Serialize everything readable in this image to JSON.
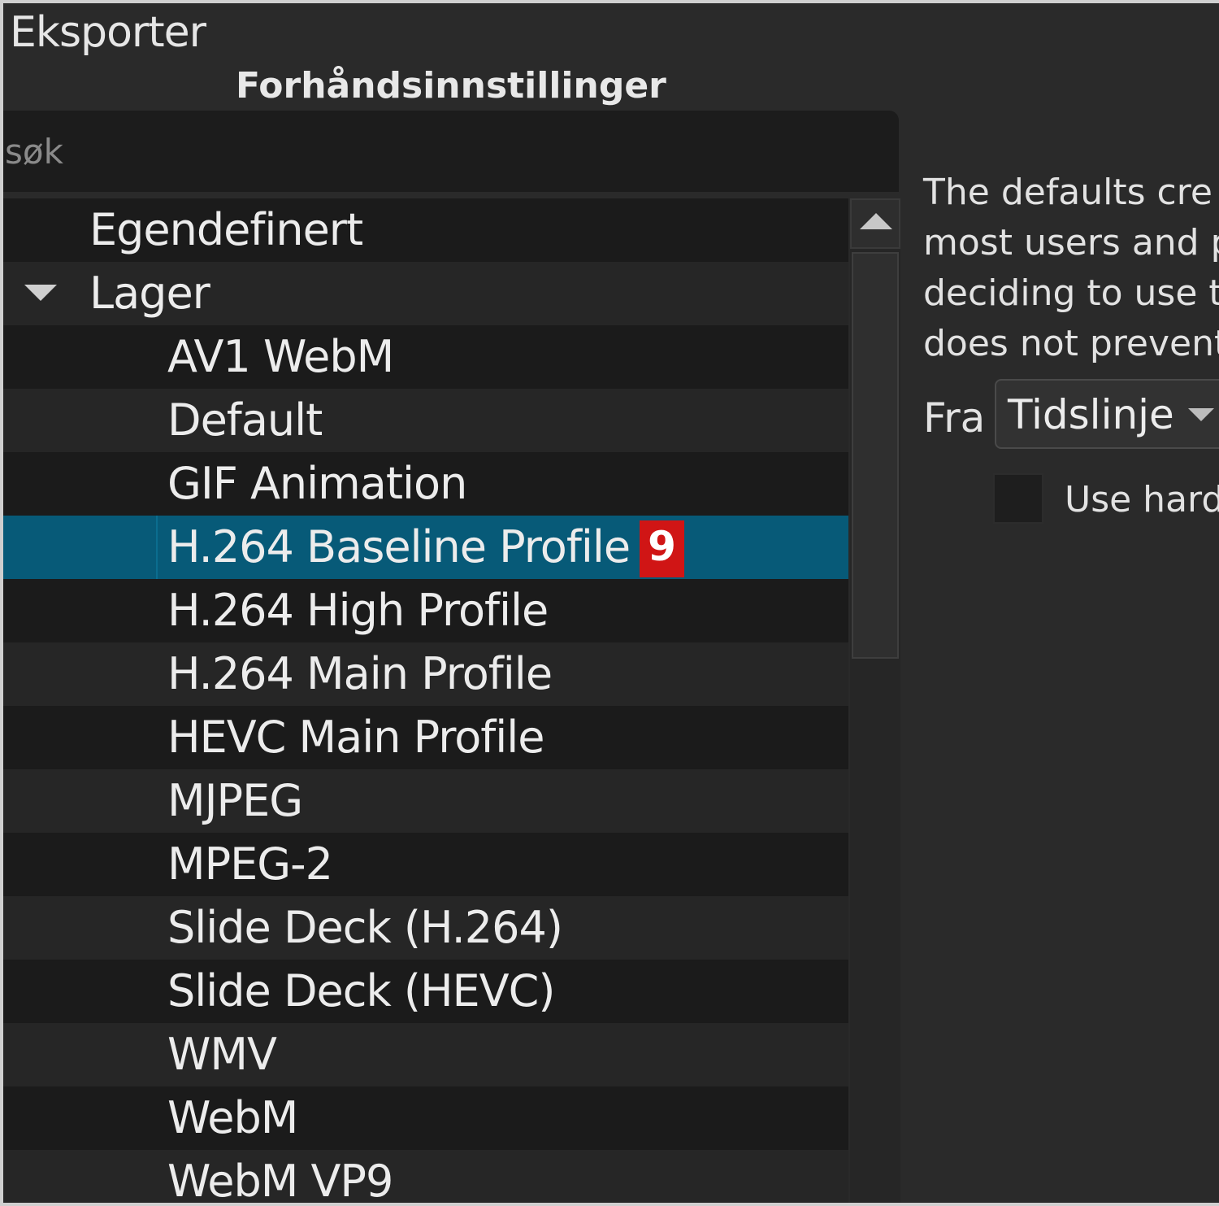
{
  "panel": {
    "title": "Eksporter",
    "subtitle": "Forhåndsinnstillinger"
  },
  "search": {
    "placeholder": "søk",
    "value": ""
  },
  "presets": {
    "custom_label": "Egendefinert",
    "stock_label": "Lager",
    "items": [
      "AV1 WebM",
      "Default",
      "GIF Animation",
      "H.264 Baseline Profile",
      "H.264 High Profile",
      "H.264 Main Profile",
      "HEVC Main Profile",
      "MJPEG",
      "MPEG-2",
      "Slide Deck (H.264)",
      "Slide Deck (HEVC)",
      "WMV",
      "WebM",
      "WebM VP9"
    ],
    "selected_index": 3,
    "badge": "9",
    "badge_color": "#d01515",
    "selection_color": "#075a78"
  },
  "details": {
    "description_lines": [
      "The defaults cre",
      "most users and p",
      "deciding to use t",
      "does not prevent"
    ],
    "from_label": "Fra",
    "from_value": "Tidslinje",
    "hardware_label": "Use hard"
  }
}
